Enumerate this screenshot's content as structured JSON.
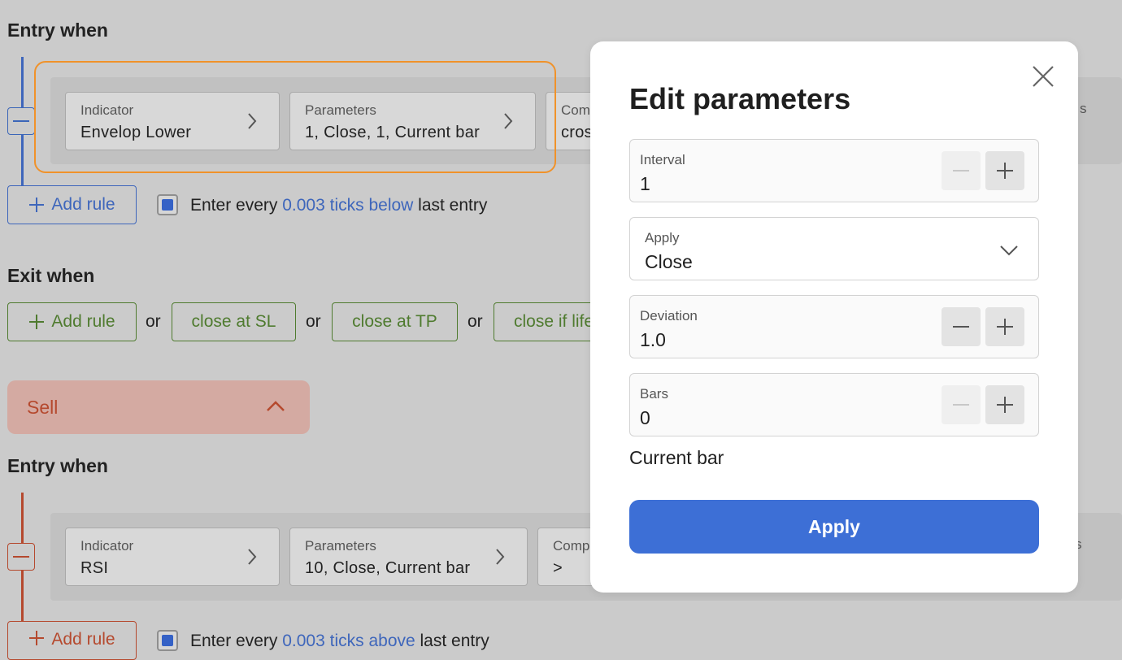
{
  "buy_entry": {
    "title": "Entry when",
    "indicator": {
      "label": "Indicator",
      "value": "Envelop Lower"
    },
    "parameters": {
      "label": "Parameters",
      "value": "1, Close, 1, Current bar"
    },
    "comparison": {
      "label": "Com",
      "value": "cros"
    },
    "right_partial": "s",
    "add_rule": "Add rule",
    "entry_every": {
      "prefix": "Enter every",
      "link": "0.003 ticks below",
      "suffix": "last entry"
    }
  },
  "exit": {
    "title": "Exit when",
    "add_rule": "Add rule",
    "or": "or",
    "close_sl": "close at SL",
    "close_tp": "close at TP",
    "close_life": "close if life"
  },
  "sell": {
    "label": "Sell"
  },
  "sell_entry": {
    "title": "Entry when",
    "indicator": {
      "label": "Indicator",
      "value": "RSI"
    },
    "parameters": {
      "label": "Parameters",
      "value": "10, Close, Current bar"
    },
    "comparison": {
      "label": "Comp",
      "value": ">"
    },
    "right_partial": "s",
    "add_rule": "Add rule",
    "entry_every": {
      "prefix": "Enter every",
      "link": "0.003 ticks above",
      "suffix": "last entry"
    }
  },
  "modal": {
    "title": "Edit parameters",
    "interval": {
      "label": "Interval",
      "value": "1"
    },
    "apply_field": {
      "label": "Apply",
      "value": "Close"
    },
    "deviation": {
      "label": "Deviation",
      "value": "1.0"
    },
    "bars": {
      "label": "Bars",
      "value": "0"
    },
    "current_bar": "Current bar",
    "apply_button": "Apply"
  },
  "colors": {
    "accent": "#3d6fd6",
    "highlight": "#f0922a",
    "buy_blue": "#3e66bb",
    "exit_green": "#4f7b2f",
    "sell_red": "#b5492e"
  }
}
